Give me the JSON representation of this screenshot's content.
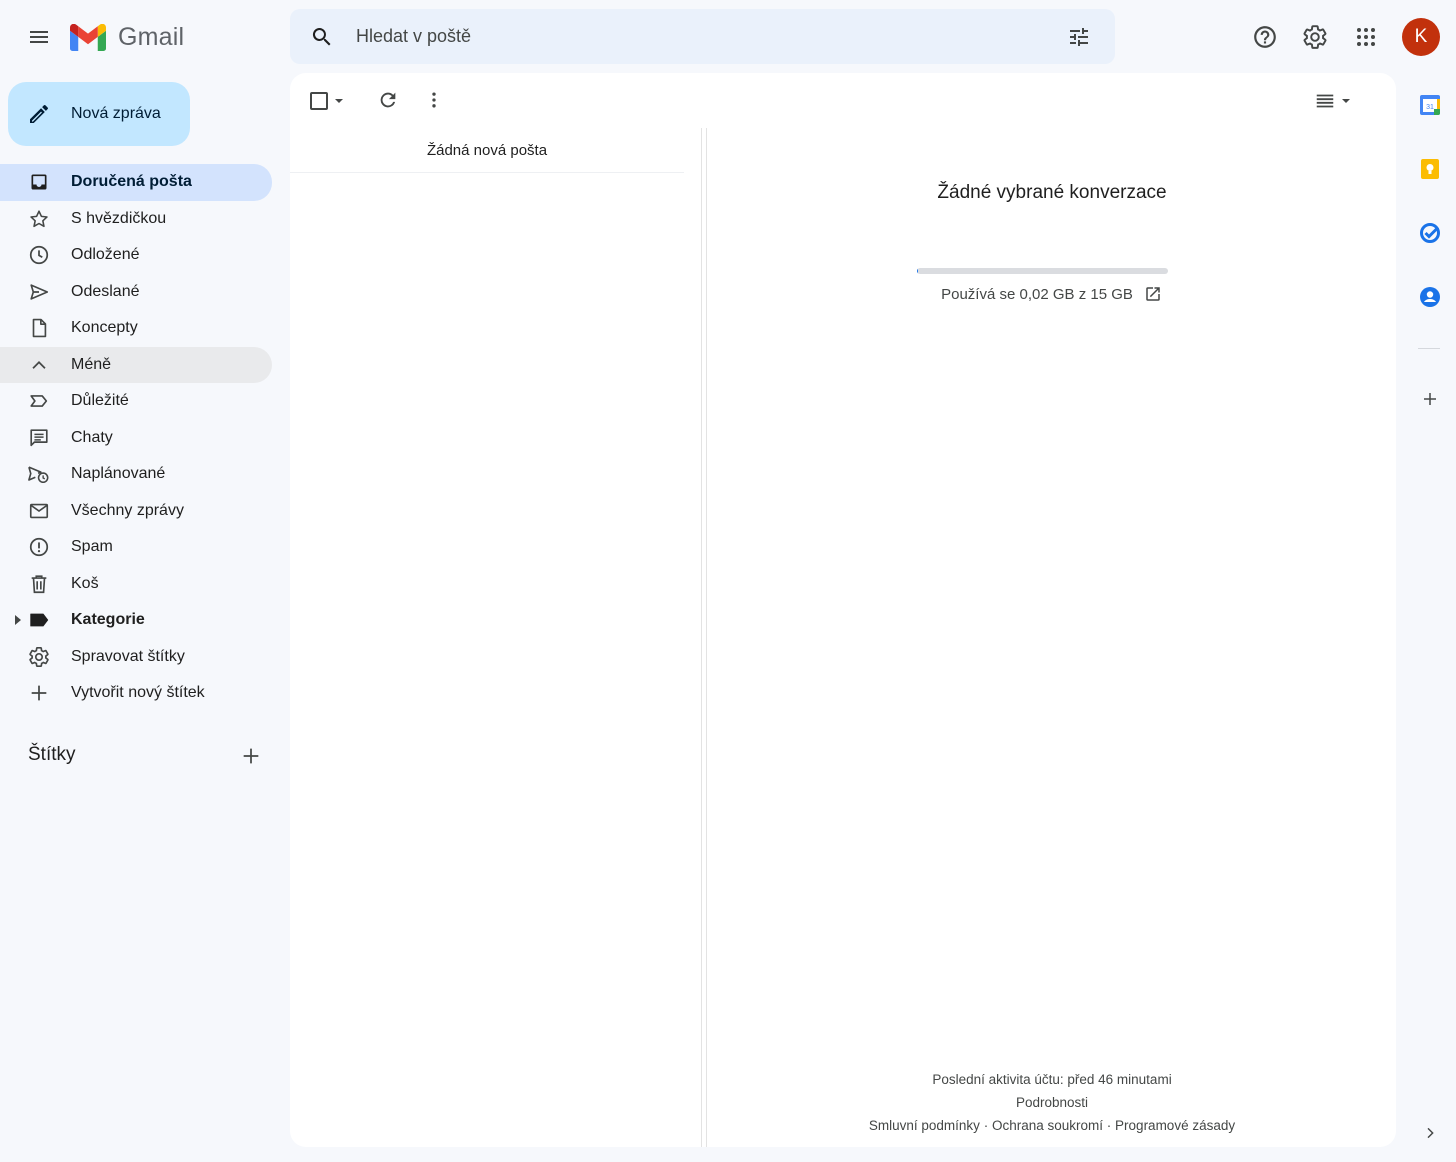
{
  "app": {
    "name": "Gmail"
  },
  "search": {
    "placeholder": "Hledat v poště"
  },
  "header": {
    "help_icon": "help-icon",
    "settings_icon": "gear-icon",
    "apps_icon": "apps-grid-icon",
    "avatar_letter": "K",
    "avatar_color": "#c2310c"
  },
  "compose": {
    "label": "Nová zpráva"
  },
  "nav": {
    "items": [
      {
        "label": "Doručená pošta",
        "icon": "inbox-icon"
      },
      {
        "label": "S hvězdičkou",
        "icon": "star-icon"
      },
      {
        "label": "Odložené",
        "icon": "clock-icon"
      },
      {
        "label": "Odeslané",
        "icon": "send-icon"
      },
      {
        "label": "Koncepty",
        "icon": "draft-icon"
      },
      {
        "label": "Méně",
        "icon": "chevron-up-icon"
      },
      {
        "label": "Důležité",
        "icon": "important-icon"
      },
      {
        "label": "Chaty",
        "icon": "chat-icon"
      },
      {
        "label": "Naplánované",
        "icon": "scheduled-icon"
      },
      {
        "label": "Všechny zprávy",
        "icon": "mail-icon"
      },
      {
        "label": "Spam",
        "icon": "spam-icon"
      },
      {
        "label": "Koš",
        "icon": "trash-icon"
      },
      {
        "label": "Kategorie",
        "icon": "label-icon"
      },
      {
        "label": "Spravovat štítky",
        "icon": "gear-icon"
      },
      {
        "label": "Vytvořit nový štítek",
        "icon": "plus-icon"
      }
    ]
  },
  "labels": {
    "title": "Štítky"
  },
  "list": {
    "empty_text": "Žádná nová pošta"
  },
  "reading": {
    "empty_text": "Žádné vybrané konverzace",
    "storage_text": "Používá se 0,02 GB z 15 GB",
    "storage_fraction": 0.0013
  },
  "footer": {
    "last_activity": "Poslední aktivita účtu: před 46 minutami",
    "details": "Podrobnosti",
    "terms": "Smluvní podmínky",
    "privacy": "Ochrana soukromí",
    "policies": "Programové zásady",
    "separator": "·"
  },
  "colors": {
    "accent": "#1a73e8",
    "active_nav": "#d3e3fd",
    "compose": "#c2e7ff"
  }
}
